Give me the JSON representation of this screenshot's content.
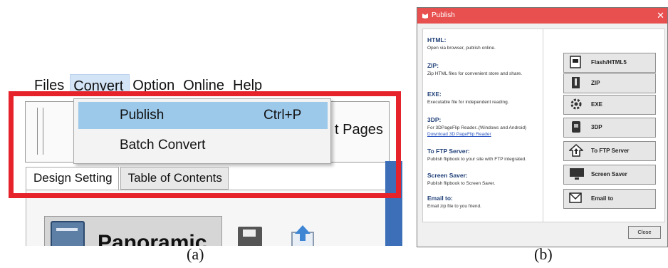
{
  "panel_a": {
    "menu": [
      "Files",
      "Convert",
      "Option",
      "Online",
      "Help"
    ],
    "dropdown": {
      "publish_label": "Publish",
      "publish_shortcut": "Ctrl+P",
      "batch_label": "Batch Convert"
    },
    "toolbar_partial_text": "t Pages",
    "tabs": [
      "Design Setting",
      "Table of Contents"
    ],
    "panoramic_label": "Panoramic",
    "caption": "(a)",
    "highlight_color": "#e6232b"
  },
  "panel_b": {
    "title": "Publish",
    "options": [
      {
        "heading": "HTML:",
        "desc": "Open via browser, publish online."
      },
      {
        "heading": "ZIP:",
        "desc": "Zip HTML files for convenient store and share."
      },
      {
        "heading": "EXE:",
        "desc": "Executable file for independent reading."
      },
      {
        "heading": "3DP:",
        "desc": "For 3DPageFlip Reader..(Windows and Android)",
        "link": "Download 3D PageFlip Reader"
      },
      {
        "heading": "To FTP Server:",
        "desc": "Publish flipbook to your site with FTP integrated."
      },
      {
        "heading": "Screen Saver:",
        "desc": "Publish flipbook to Screen Saver."
      },
      {
        "heading": "Email to:",
        "desc": "Email zip file to you friend."
      }
    ],
    "buttons": [
      "Flash/HTML5",
      "ZIP",
      "EXE",
      "3DP",
      "To FTP Server",
      "Screen Saver",
      "Email to"
    ],
    "close_label": "Close",
    "caption": "(b)"
  }
}
